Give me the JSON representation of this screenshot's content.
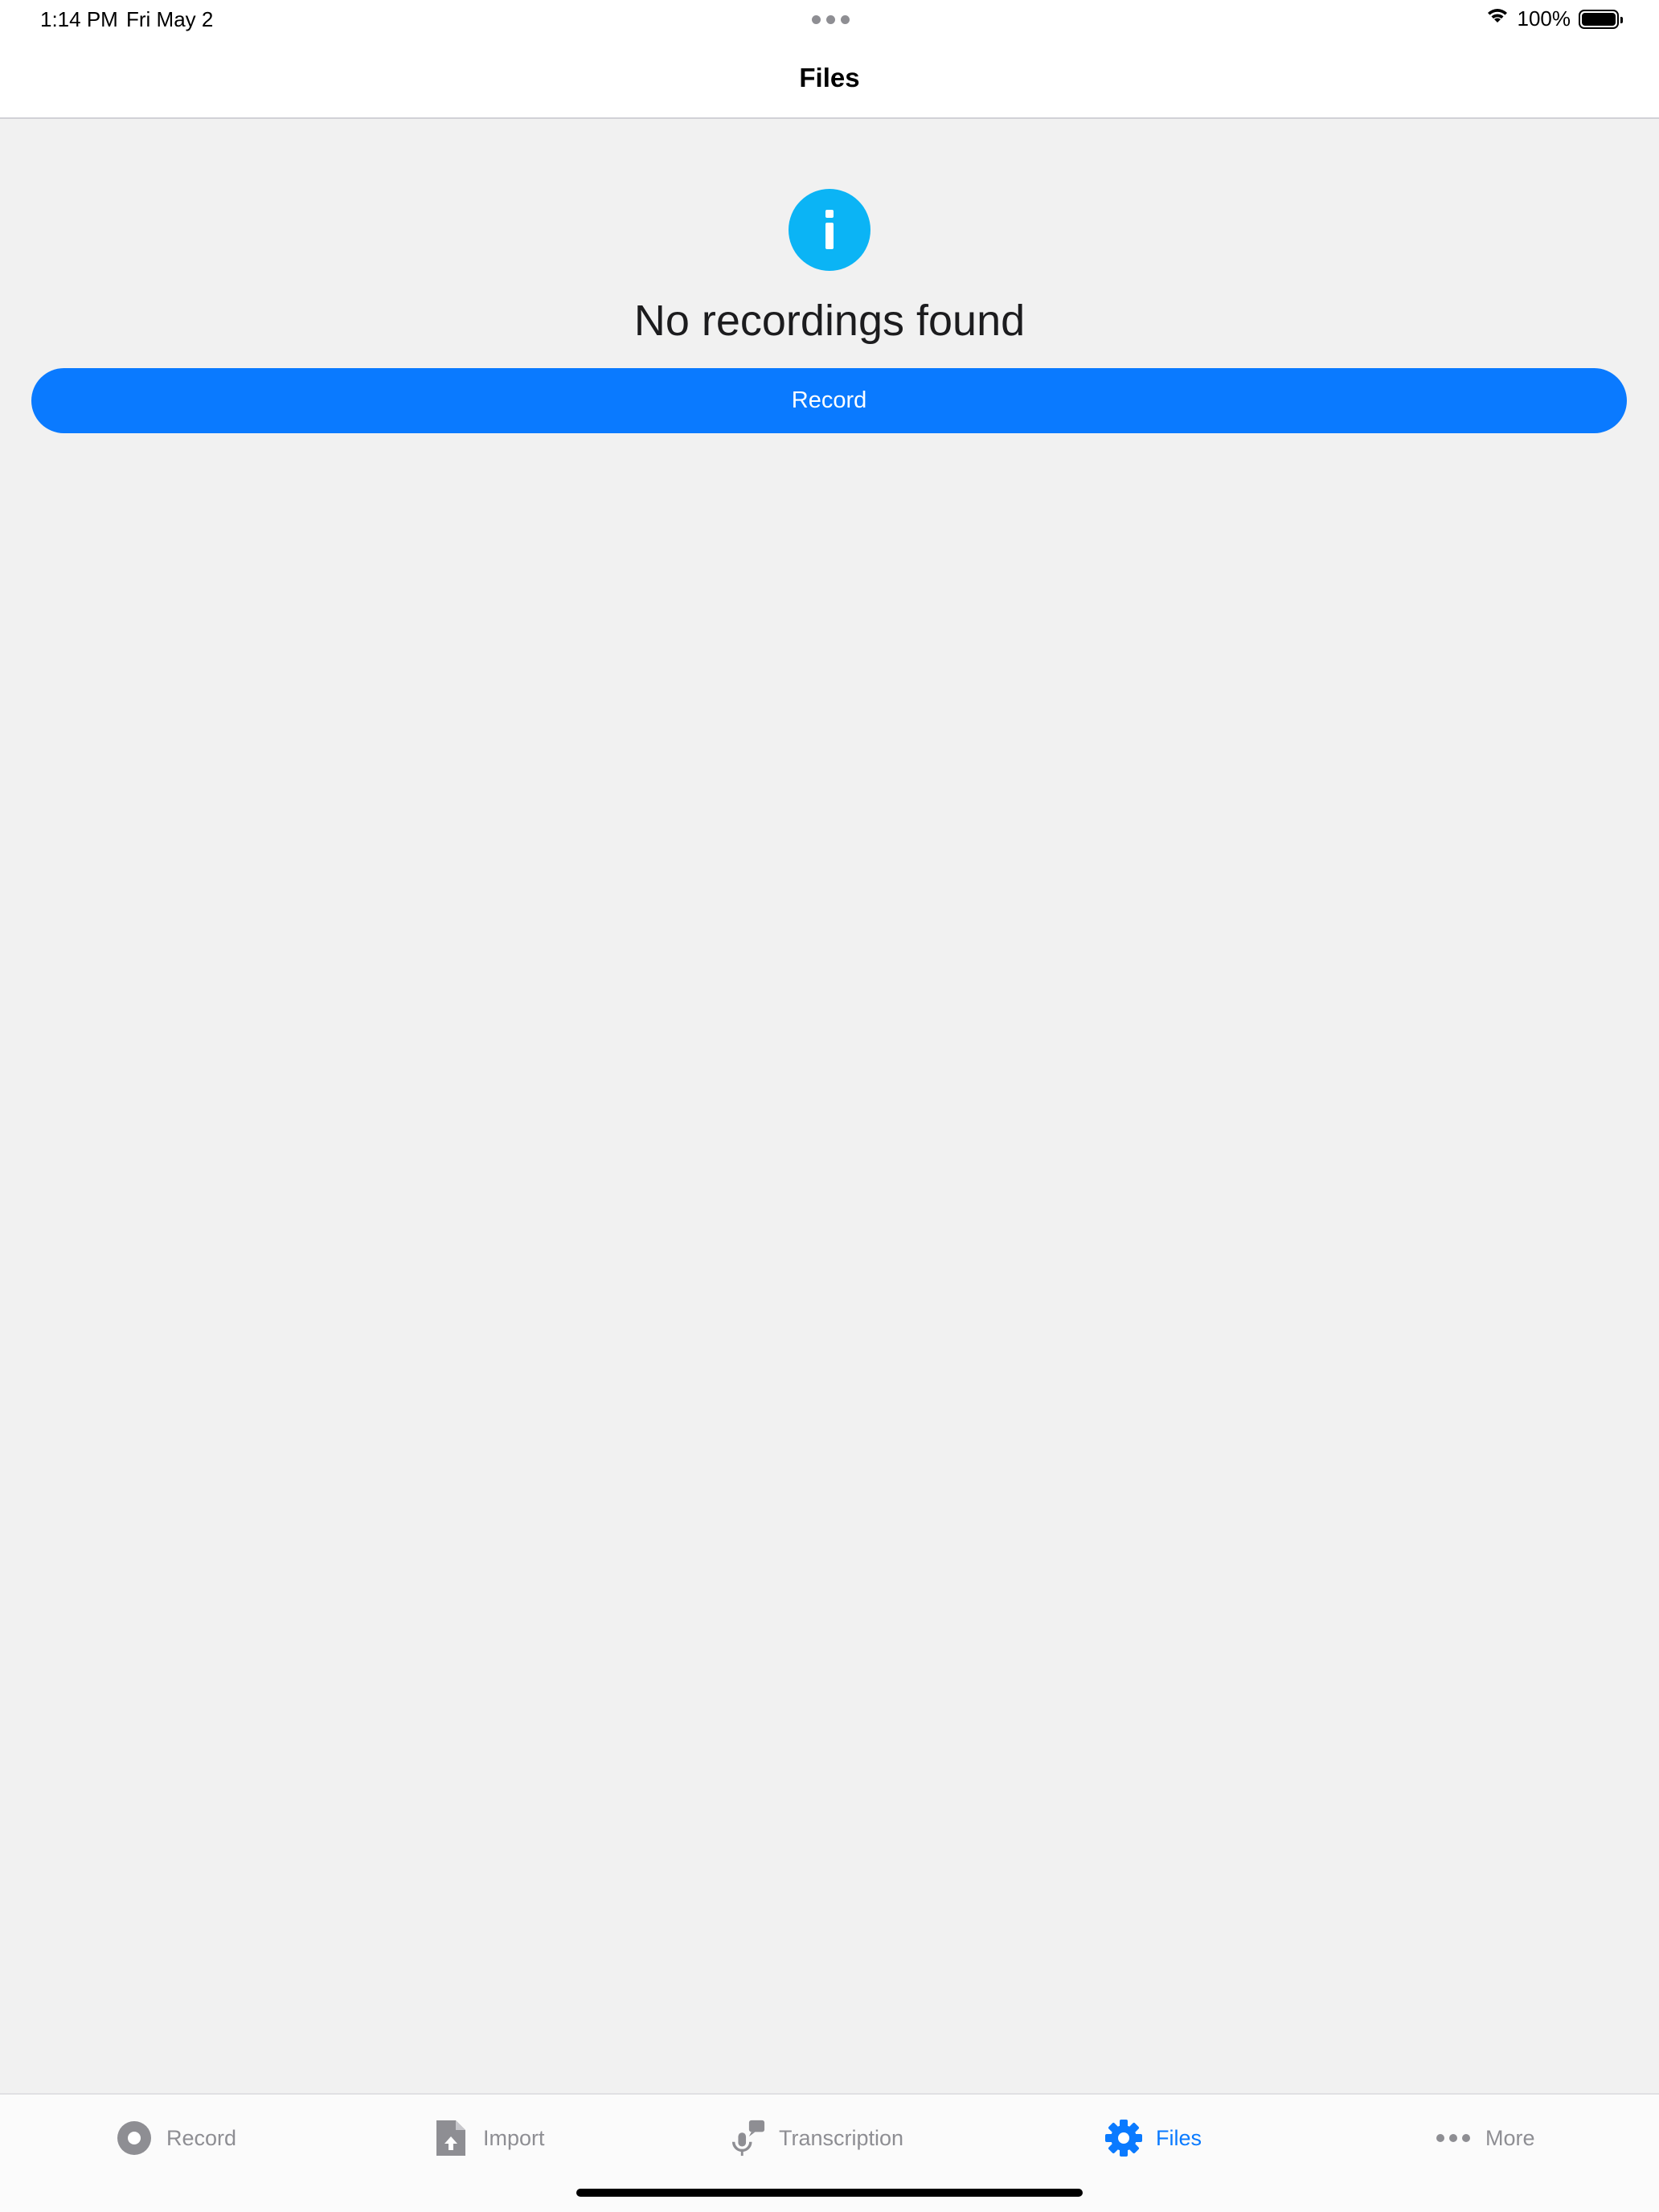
{
  "status_bar": {
    "time": "1:14 PM",
    "date": "Fri May 2",
    "battery": "100%",
    "icons": [
      "multitask-dots-icon",
      "wifi-icon",
      "battery-icon"
    ]
  },
  "nav": {
    "title": "Files"
  },
  "empty_state": {
    "icon": "info-icon",
    "message": "No recordings found",
    "button_label": "Record"
  },
  "tabbar": {
    "tabs": [
      {
        "label": "Record",
        "icon": "record-icon",
        "active": false
      },
      {
        "label": "Import",
        "icon": "import-file-icon",
        "active": false
      },
      {
        "label": "Transcription",
        "icon": "transcription-icon",
        "active": false
      },
      {
        "label": "Files",
        "icon": "gear-icon",
        "active": true
      },
      {
        "label": "More",
        "icon": "more-dots-icon",
        "active": false
      }
    ]
  },
  "colors": {
    "accent": "#0a7aff",
    "info": "#0bb4f5",
    "inactive": "#8e8e93",
    "background": "#f1f1f1"
  }
}
